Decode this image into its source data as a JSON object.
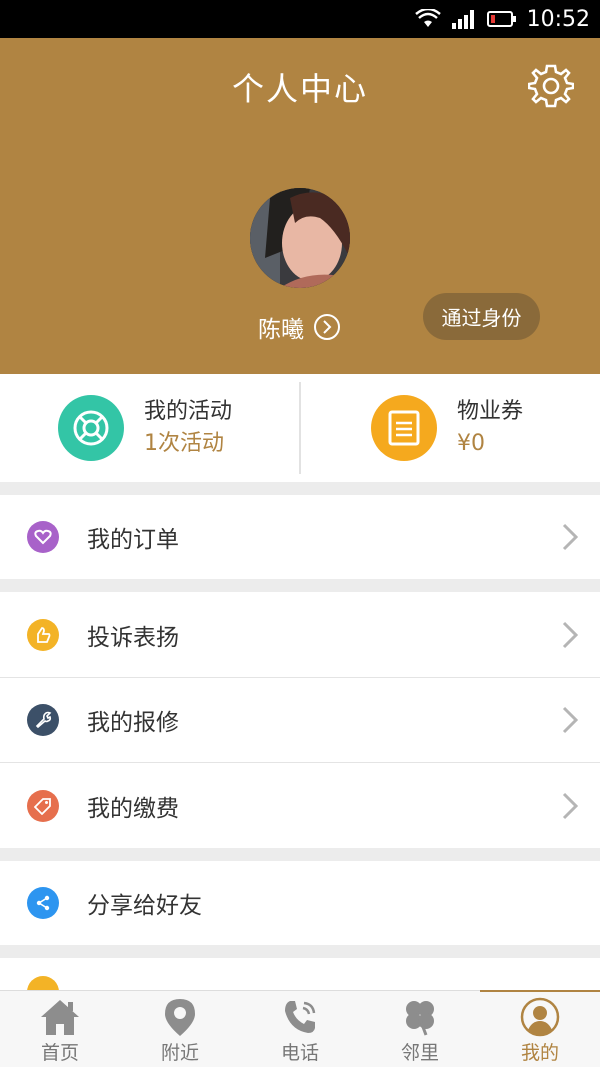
{
  "status_bar": {
    "time": "10:52"
  },
  "header": {
    "title": "个人中心",
    "username": "陈曦",
    "identity_button": "通过身份"
  },
  "stats": {
    "activity": {
      "label": "我的活动",
      "value": "1次活动"
    },
    "coupon": {
      "label": "物业券",
      "value": "¥0"
    }
  },
  "menu": {
    "orders": "我的订单",
    "complaint": "投诉表扬",
    "repair": "我的报修",
    "payment": "我的缴费",
    "share": "分享给好友"
  },
  "tabs": [
    {
      "label": "首页",
      "icon": "home-icon"
    },
    {
      "label": "附近",
      "icon": "location-pin-icon"
    },
    {
      "label": "电话",
      "icon": "phone-icon"
    },
    {
      "label": "邻里",
      "icon": "clover-icon"
    },
    {
      "label": "我的",
      "icon": "user-icon",
      "active": true
    }
  ],
  "colors": {
    "accent": "#b08442",
    "activity_icon": "#33c5a6",
    "coupon_icon": "#f5a91e",
    "orders_icon": "#a862c9",
    "complaint_icon": "#f3b326",
    "repair_icon": "#3c5068",
    "payment_icon": "#e66f4d",
    "share_icon": "#2d95f0"
  }
}
